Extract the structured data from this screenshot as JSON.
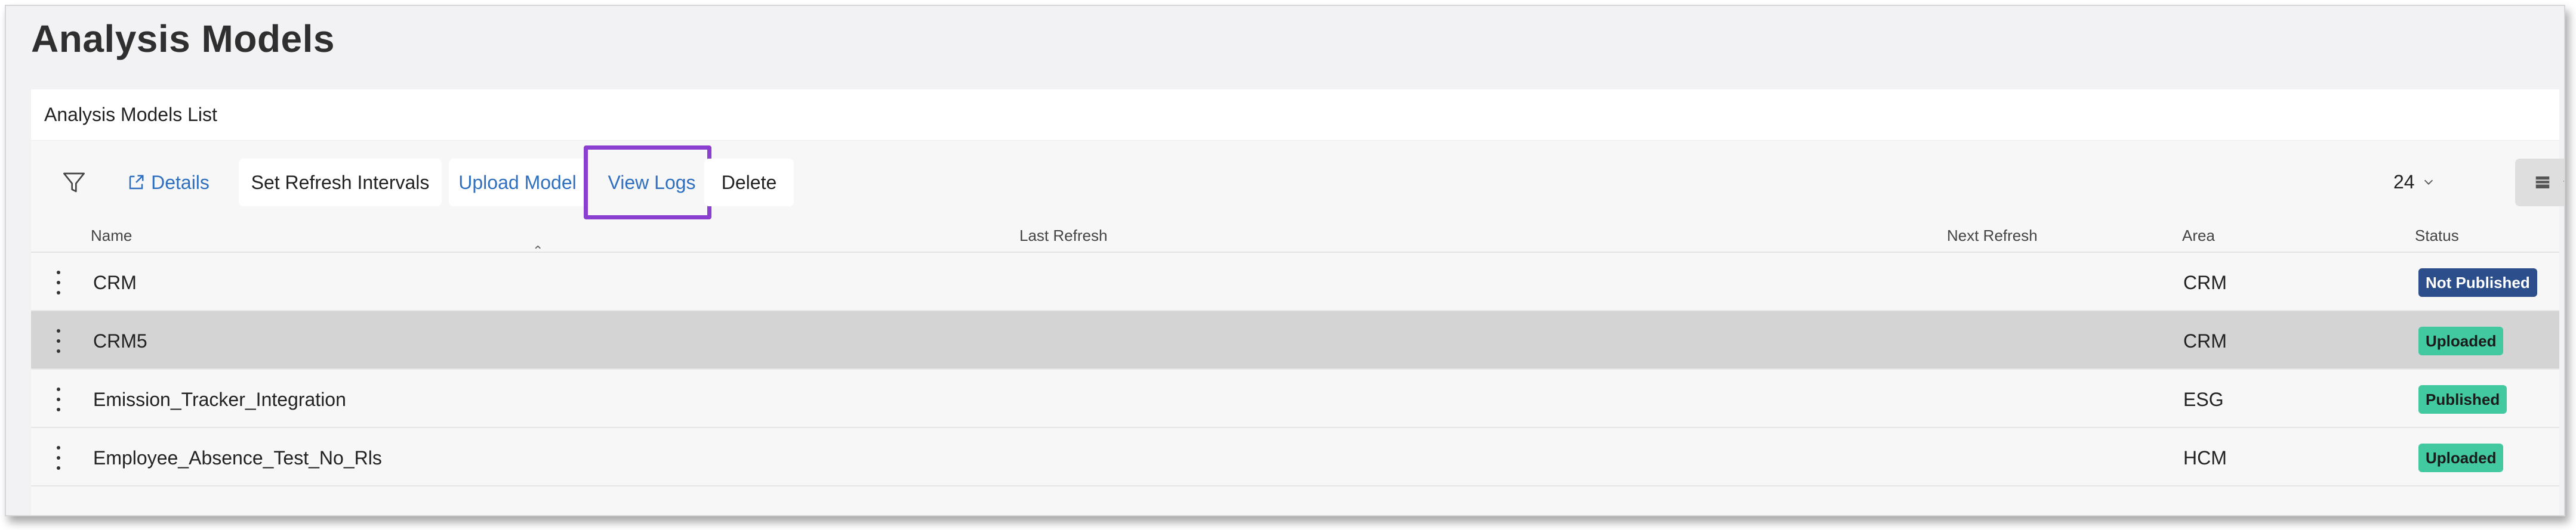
{
  "page": {
    "title": "Analysis Models"
  },
  "panel": {
    "title": "Analysis Models List"
  },
  "toolbar": {
    "details_label": "Details",
    "refresh_intervals_label": "Set Refresh Intervals",
    "upload_label": "Upload Model",
    "view_logs_label": "View Logs",
    "delete_label": "Delete",
    "page_size": "24"
  },
  "columns": {
    "name": "Name",
    "last_refresh": "Last Refresh",
    "next_refresh": "Next Refresh",
    "area": "Area",
    "status": "Status"
  },
  "rows": [
    {
      "name": "CRM",
      "last_refresh": "",
      "next_refresh": "",
      "area": "CRM",
      "status": "Not Published"
    },
    {
      "name": "CRM5",
      "last_refresh": "",
      "next_refresh": "",
      "area": "CRM",
      "status": "Uploaded"
    },
    {
      "name": "Emission_Tracker_Integration",
      "last_refresh": "",
      "next_refresh": "",
      "area": "ESG",
      "status": "Published"
    },
    {
      "name": "Employee_Absence_Test_No_Rls",
      "last_refresh": "",
      "next_refresh": "",
      "area": "HCM",
      "status": "Uploaded"
    }
  ],
  "colors": {
    "highlight": "#8a3fd1",
    "link": "#2f6fbf",
    "status_not_published": "#2c4f8c",
    "status_uploaded": "#43c9a0",
    "status_published": "#43c9a0",
    "selected_row": "#d4d4d4"
  },
  "icons": [
    "filter-icon",
    "external-link-icon",
    "chevron-down-icon",
    "list-view-icon",
    "kebab-menu-icon",
    "sort-ascending-icon"
  ]
}
